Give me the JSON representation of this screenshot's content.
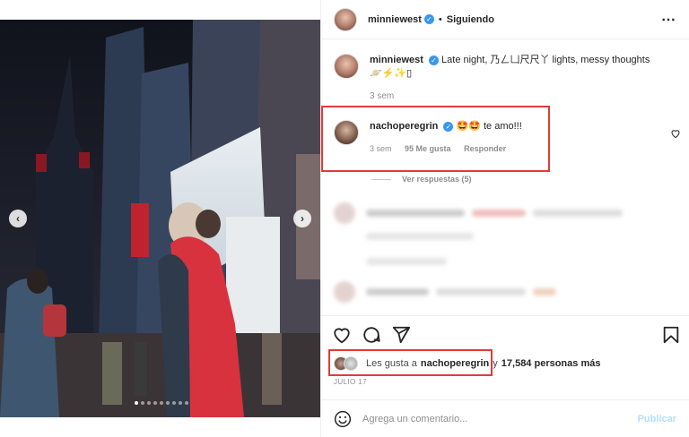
{
  "post": {
    "author": "minniewest",
    "follow_status": "Siguiendo",
    "more_icon": "ellipsis-icon",
    "caption_text": "Late night, 乃ㄥ凵尺尺丫 lights, messy thoughts",
    "caption_emojis": "🪐⚡✨▯",
    "caption_time": "3 sem",
    "carousel": {
      "total": 9,
      "current": 1,
      "prev_icon": "chevron-left-icon",
      "next_icon": "chevron-right-icon"
    }
  },
  "highlighted_comment": {
    "user": "nachoperegrin",
    "emojis": "🤩🤩",
    "text": "te amo!!!",
    "time": "3 sem",
    "likes": "95 Me gusta",
    "reply_label": "Responder",
    "view_replies": "Ver respuestas (5)",
    "like_icon": "heart-outline-icon"
  },
  "actions": {
    "like_icon": "heart-icon",
    "comment_icon": "comment-icon",
    "share_icon": "paper-plane-icon",
    "save_icon": "bookmark-icon"
  },
  "likes_line": {
    "prefix": "Les gusta a",
    "user": "nachoperegrin",
    "middle": "y",
    "count": "17,584 personas más"
  },
  "date": "JULIO 17",
  "add_comment": {
    "placeholder": "Agrega un comentario...",
    "publish_label": "Publicar",
    "emoji_icon": "smiley-icon"
  },
  "colors": {
    "accent": "#3897f0",
    "highlight_box": "#e23b3b",
    "publish_disabled": "#b2dffc"
  }
}
